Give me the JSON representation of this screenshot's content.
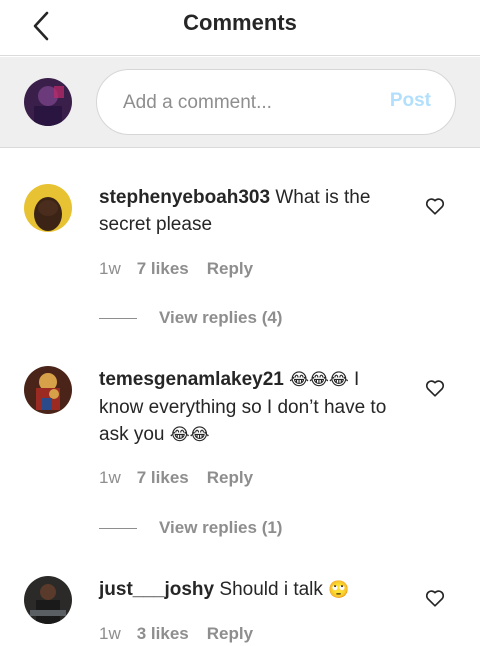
{
  "header": {
    "title": "Comments",
    "back_icon": "chevron-left-icon"
  },
  "composer": {
    "placeholder": "Add a comment...",
    "post_label": "Post",
    "post_color": "#b2dffc"
  },
  "comments": [
    {
      "username": "stephenyeboah303",
      "text": "What is the secret please",
      "emoji": "",
      "time": "1w",
      "likes": "7 likes",
      "reply_label": "Reply",
      "view_replies": "View replies (4)"
    },
    {
      "username": "temesgenamlakey21",
      "emoji_lead": "😂😂😂",
      "text": "I know everything so I don’t have to ask you",
      "emoji": "😂😂",
      "time": "1w",
      "likes": "7 likes",
      "reply_label": "Reply",
      "view_replies": "View replies (1)"
    },
    {
      "username": "just___joshy",
      "text": "Should i talk",
      "emoji": "🙄",
      "time": "1w",
      "likes": "3 likes",
      "reply_label": "Reply"
    }
  ]
}
